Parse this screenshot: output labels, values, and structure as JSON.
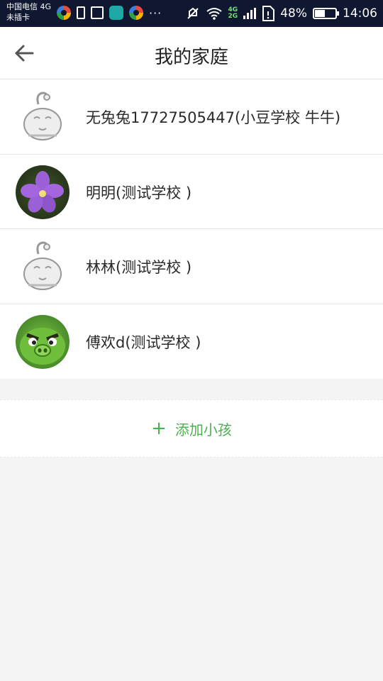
{
  "status_bar": {
    "carrier_line1": "中国电信 4G",
    "carrier_line2": "未插卡",
    "network_badge_top": "4G",
    "network_badge_bottom": "2G",
    "battery_percent": "48%",
    "time": "14:06"
  },
  "header": {
    "title": "我的家庭",
    "back_icon": "arrow-left-icon"
  },
  "children": [
    {
      "name": "无兔兔17727505447(小豆学校 牛牛)",
      "avatar": "default-mascot"
    },
    {
      "name": "明明(测试学校 )",
      "avatar": "flower-photo"
    },
    {
      "name": "林林(测试学校 )",
      "avatar": "default-mascot"
    },
    {
      "name": "傅欢d(测试学校 )",
      "avatar": "green-pig"
    }
  ],
  "add_child": {
    "label": "添加小孩",
    "icon": "plus-icon"
  },
  "colors": {
    "accent": "#4caf50",
    "status_bar": "#0f1830",
    "background": "#f4f4f4"
  }
}
